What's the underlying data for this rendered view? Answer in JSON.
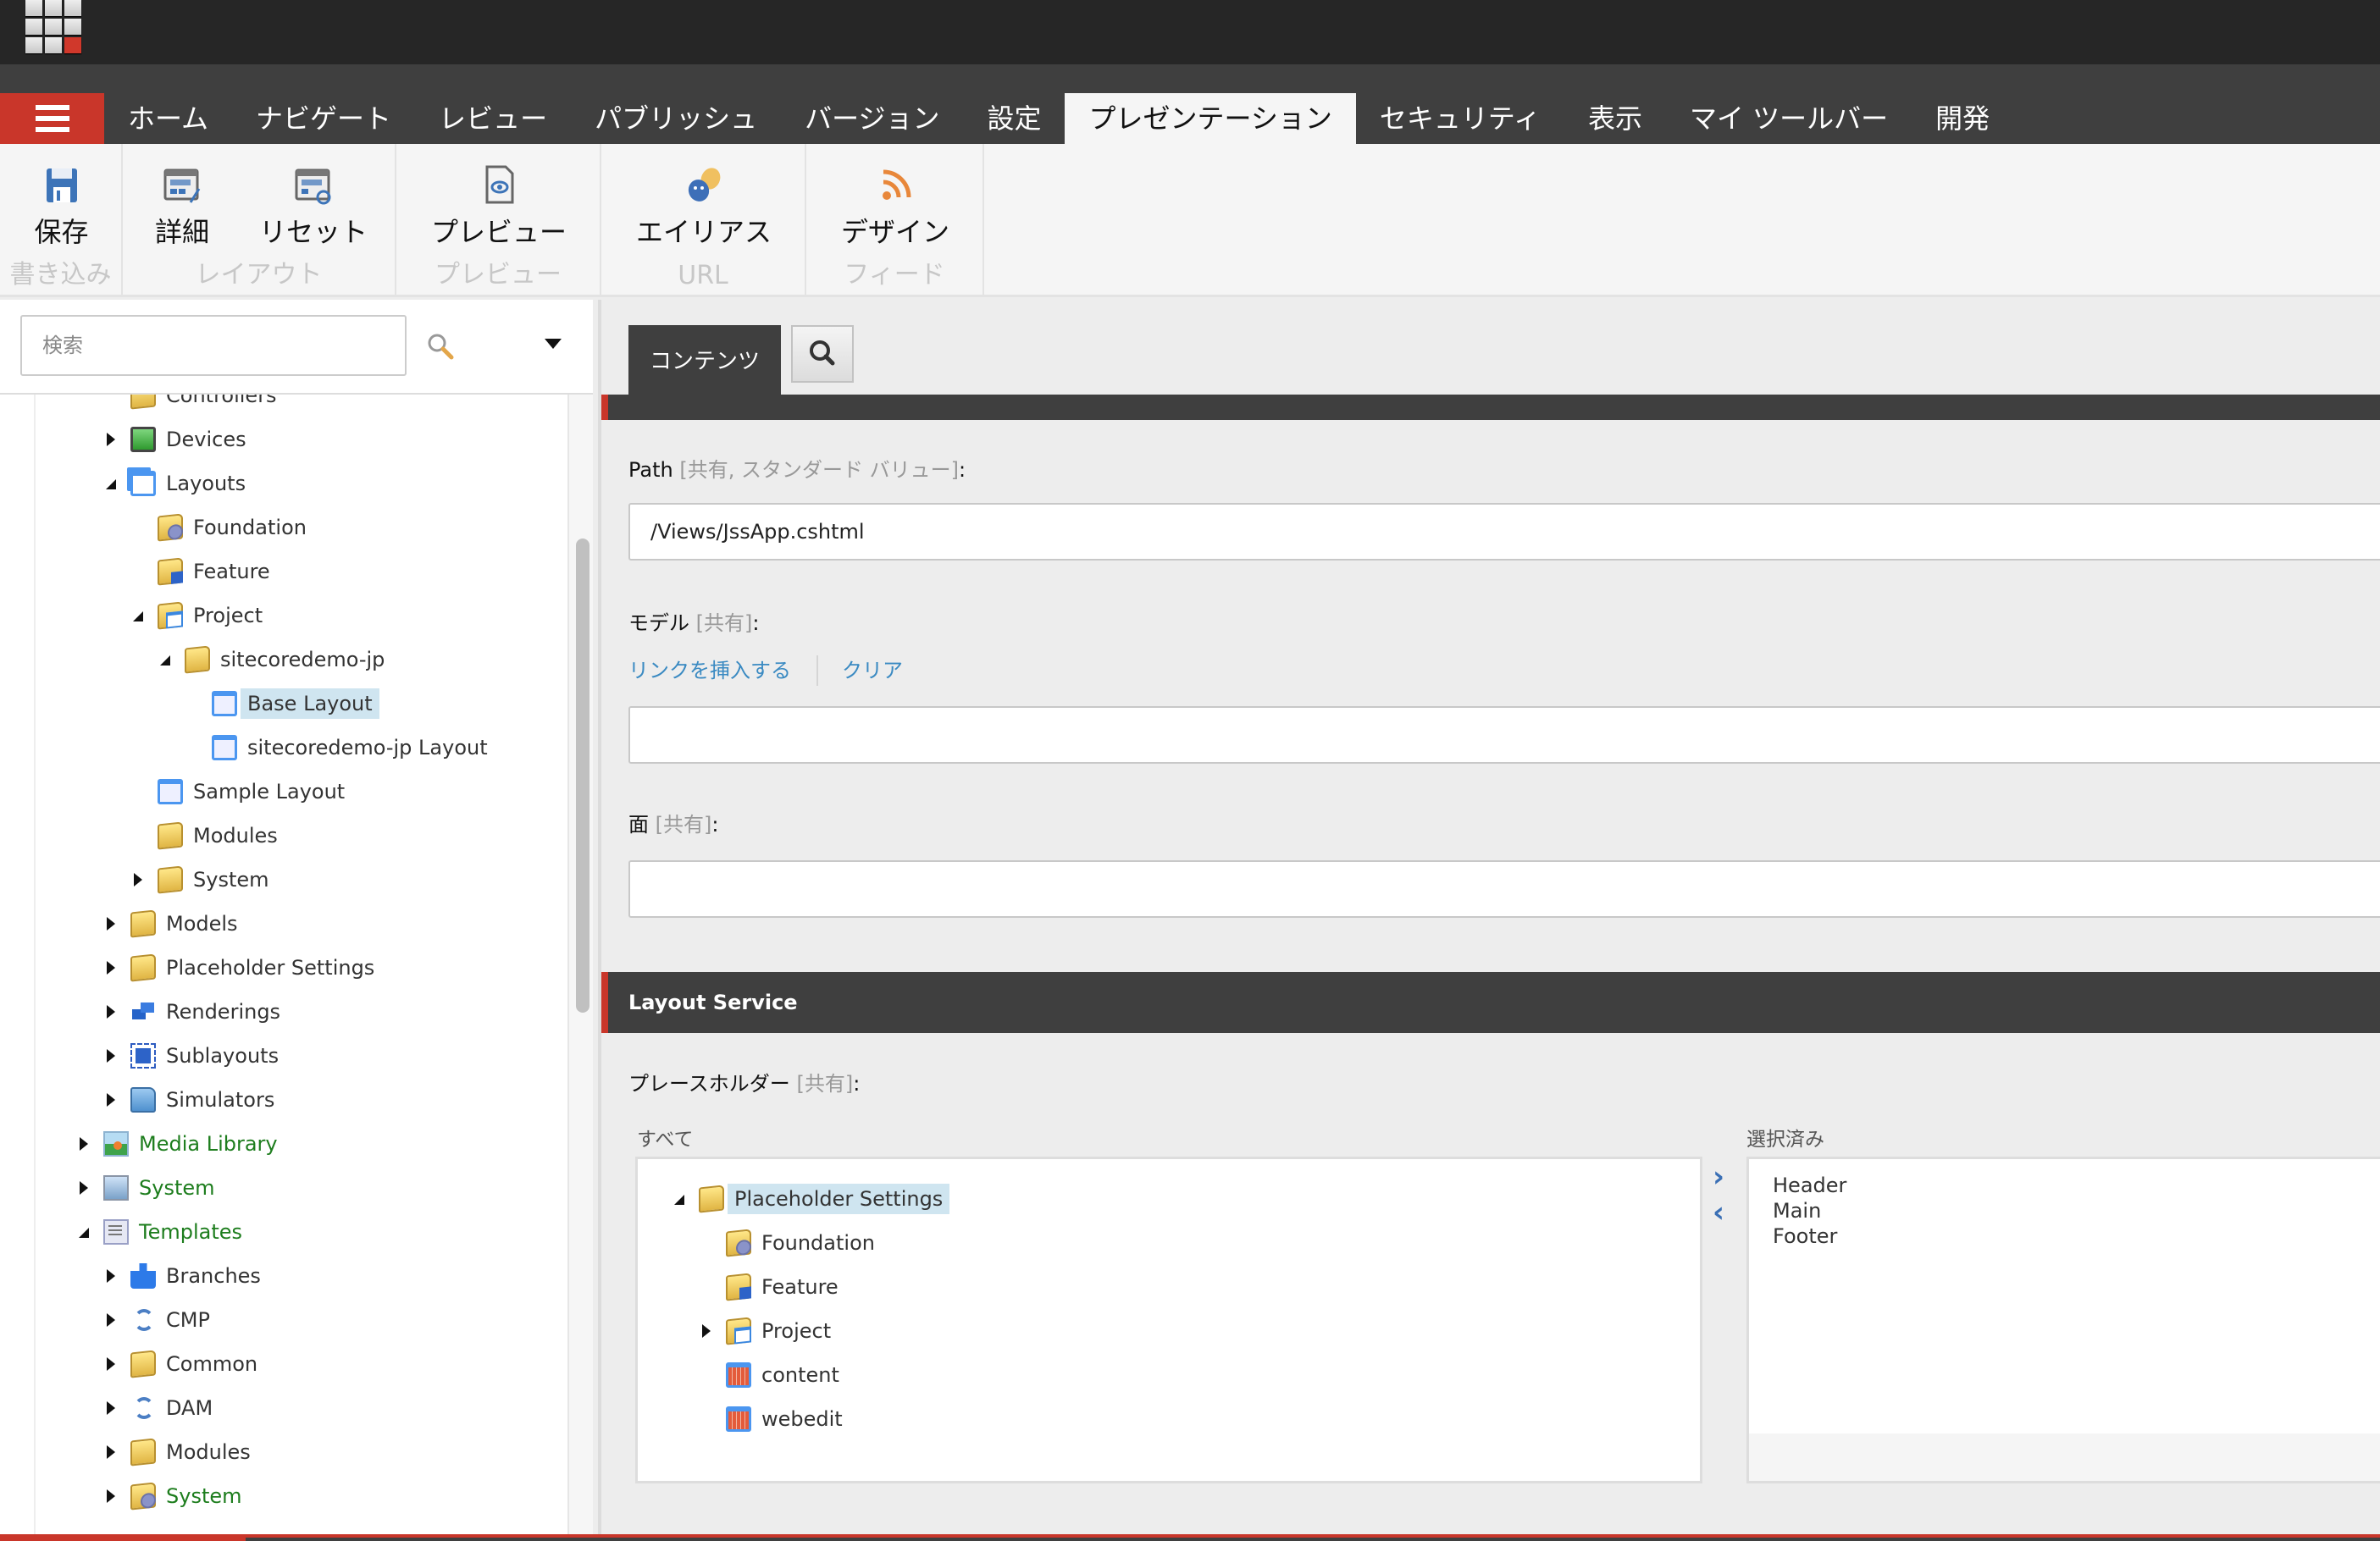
{
  "app": {
    "logo": "sitecore-launchpad-logo"
  },
  "nav": {
    "menu_icon": "hamburger-icon",
    "tabs": [
      {
        "label": "ホーム",
        "active": false
      },
      {
        "label": "ナビゲート",
        "active": false
      },
      {
        "label": "レビュー",
        "active": false
      },
      {
        "label": "パブリッシュ",
        "active": false
      },
      {
        "label": "バージョン",
        "active": false
      },
      {
        "label": "設定",
        "active": false
      },
      {
        "label": "プレゼンテーション",
        "active": true
      },
      {
        "label": "セキュリティ",
        "active": false
      },
      {
        "label": "表示",
        "active": false
      },
      {
        "label": "マイ ツールバー",
        "active": false
      },
      {
        "label": "開発",
        "active": false
      }
    ]
  },
  "ribbon": {
    "groups": [
      {
        "label": "書き込み",
        "buttons": [
          {
            "label": "保存",
            "icon": "save-icon"
          }
        ]
      },
      {
        "label": "レイアウト",
        "buttons": [
          {
            "label": "詳細",
            "icon": "layout-details-icon"
          },
          {
            "label": "リセット",
            "icon": "layout-reset-icon"
          }
        ]
      },
      {
        "label": "プレビュー",
        "buttons": [
          {
            "label": "プレビュー",
            "icon": "preview-icon"
          }
        ]
      },
      {
        "label": "URL",
        "buttons": [
          {
            "label": "エイリアス",
            "icon": "alias-masks-icon"
          }
        ]
      },
      {
        "label": "フィード",
        "buttons": [
          {
            "label": "デザイン",
            "icon": "rss-feed-icon"
          }
        ]
      }
    ]
  },
  "search": {
    "placeholder": "検索",
    "value": ""
  },
  "tree": {
    "items": [
      {
        "label": "Controllers",
        "level": 3,
        "arrow": "none",
        "icon": "folder",
        "partial": true
      },
      {
        "label": "Devices",
        "level": 3,
        "arrow": "right",
        "icon": "device"
      },
      {
        "label": "Layouts",
        "level": 3,
        "arrow": "down",
        "icon": "layouts"
      },
      {
        "label": "Foundation",
        "level": 4,
        "arrow": "none",
        "icon": "folder-foundation"
      },
      {
        "label": "Feature",
        "level": 4,
        "arrow": "none",
        "icon": "folder-feature"
      },
      {
        "label": "Project",
        "level": 4,
        "arrow": "down",
        "icon": "folder-project"
      },
      {
        "label": "sitecoredemo-jp",
        "level": 5,
        "arrow": "down",
        "icon": "folder"
      },
      {
        "label": "Base Layout",
        "level": 6,
        "arrow": "none",
        "icon": "layout",
        "selected": true
      },
      {
        "label": "sitecoredemo-jp Layout",
        "level": 6,
        "arrow": "none",
        "icon": "layout"
      },
      {
        "label": "Sample Layout",
        "level": 4,
        "arrow": "none",
        "icon": "layout"
      },
      {
        "label": "Modules",
        "level": 4,
        "arrow": "none",
        "icon": "folder"
      },
      {
        "label": "System",
        "level": 4,
        "arrow": "right",
        "icon": "folder"
      },
      {
        "label": "Models",
        "level": 3,
        "arrow": "right",
        "icon": "folder"
      },
      {
        "label": "Placeholder Settings",
        "level": 3,
        "arrow": "right",
        "icon": "folder"
      },
      {
        "label": "Renderings",
        "level": 3,
        "arrow": "right",
        "icon": "renderings"
      },
      {
        "label": "Sublayouts",
        "level": 3,
        "arrow": "right",
        "icon": "sublayouts"
      },
      {
        "label": "Simulators",
        "level": 3,
        "arrow": "right",
        "icon": "simulators"
      },
      {
        "label": "Media Library",
        "level": 2,
        "arrow": "right",
        "icon": "media",
        "green": true
      },
      {
        "label": "System",
        "level": 2,
        "arrow": "right",
        "icon": "system",
        "green": true
      },
      {
        "label": "Templates",
        "level": 2,
        "arrow": "down",
        "icon": "templates",
        "green": true
      },
      {
        "label": "Branches",
        "level": 3,
        "arrow": "right",
        "icon": "branches"
      },
      {
        "label": "CMP",
        "level": 3,
        "arrow": "right",
        "icon": "sync"
      },
      {
        "label": "Common",
        "level": 3,
        "arrow": "right",
        "icon": "folder"
      },
      {
        "label": "DAM",
        "level": 3,
        "arrow": "right",
        "icon": "sync"
      },
      {
        "label": "Modules",
        "level": 3,
        "arrow": "right",
        "icon": "folder"
      },
      {
        "label": "System",
        "level": 3,
        "arrow": "right",
        "icon": "folder-foundation",
        "green": true
      }
    ]
  },
  "content": {
    "tab_label": "コンテンツ",
    "search_icon": "search-icon",
    "path": {
      "label": "Path",
      "qualifier": "[共有, スタンダード バリュー]",
      "value": "/Views/JssApp.cshtml"
    },
    "model": {
      "label": "モデル",
      "qualifier": "[共有]",
      "insert_link": "リンクを挿入する",
      "clear": "クリア",
      "value": ""
    },
    "face": {
      "label": "面",
      "qualifier": "[共有]",
      "value": ""
    },
    "layout_service": {
      "section_title": "Layout Service",
      "placeholders_label": "プレースホルダー",
      "placeholders_qualifier": "[共有]",
      "all_label": "すべて",
      "selected_label": "選択済み",
      "all_tree": [
        {
          "label": "Placeholder Settings",
          "level": 0,
          "arrow": "down",
          "icon": "folder",
          "selected": true
        },
        {
          "label": "Foundation",
          "level": 1,
          "arrow": "none",
          "icon": "folder-foundation"
        },
        {
          "label": "Feature",
          "level": 1,
          "arrow": "none",
          "icon": "folder-feature"
        },
        {
          "label": "Project",
          "level": 1,
          "arrow": "right",
          "icon": "folder-project"
        },
        {
          "label": "content",
          "level": 1,
          "arrow": "none",
          "icon": "placeholder"
        },
        {
          "label": "webedit",
          "level": 1,
          "arrow": "none",
          "icon": "placeholder"
        }
      ],
      "selected_items": [
        "Header",
        "Main",
        "Footer"
      ]
    }
  },
  "colors": {
    "accent_red": "#c9362a",
    "topbar": "#262626",
    "navbar": "#3f3f3f",
    "link_blue": "#3a8ac2",
    "tree_green": "#1d7d1d",
    "selection": "#cfe5f0"
  }
}
